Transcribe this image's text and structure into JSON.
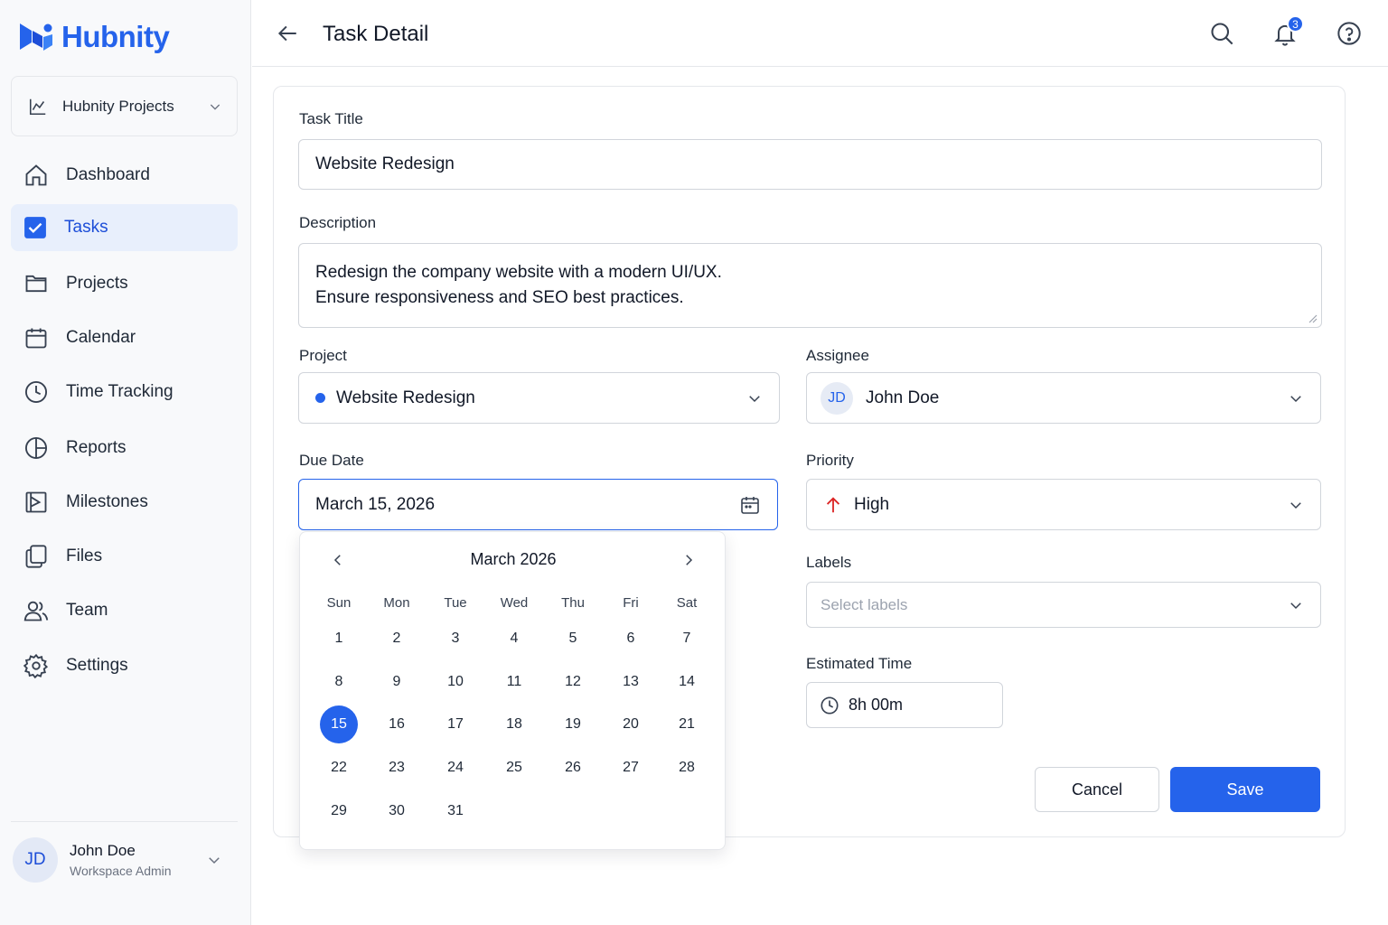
{
  "app": {
    "name": "Hubnity"
  },
  "workspace": {
    "label": "Hubnity Projects"
  },
  "sidebar": {
    "items": [
      {
        "label": "Dashboard",
        "icon": "home-icon"
      },
      {
        "label": "Tasks",
        "icon": "checkbox-icon",
        "active": true
      },
      {
        "label": "Projects",
        "icon": "folder-icon"
      },
      {
        "label": "Calendar",
        "icon": "calendar-icon"
      },
      {
        "label": "Time Tracking",
        "icon": "clock-icon"
      },
      {
        "label": "Reports",
        "icon": "pie-chart-icon"
      },
      {
        "label": "Milestones",
        "icon": "milestone-icon"
      },
      {
        "label": "Files",
        "icon": "files-icon"
      },
      {
        "label": "Team",
        "icon": "team-icon"
      },
      {
        "label": "Settings",
        "icon": "gear-icon"
      }
    ]
  },
  "user": {
    "initials": "JD",
    "name": "John Doe",
    "role": "Workspace Admin"
  },
  "header": {
    "title": "Task Detail",
    "notifications": "3"
  },
  "form": {
    "title_label": "Task Title",
    "title_value": "Website Redesign",
    "description_label": "Description",
    "description_line1": "Redesign the company website with a modern UI/UX.",
    "description_line2": "Ensure responsiveness and SEO best practices.",
    "project_label": "Project",
    "project_value": "Website Redesign",
    "assignee_label": "Assignee",
    "assignee_initials": "JD",
    "assignee_value": "John Doe",
    "due_date_label": "Due Date",
    "due_date_value": "March 15, 2026",
    "priority_label": "Priority",
    "priority_value": "High",
    "labels_label": "Labels",
    "labels_placeholder": "Select labels",
    "estimated_label": "Estimated Time",
    "estimated_value": "8h 00m",
    "cancel_label": "Cancel",
    "save_label": "Save"
  },
  "calendar": {
    "month": "March 2026",
    "weekdays": [
      "Sun",
      "Mon",
      "Tue",
      "Wed",
      "Thu",
      "Fri",
      "Sat"
    ],
    "days": [
      "1",
      "2",
      "3",
      "4",
      "5",
      "6",
      "7",
      "8",
      "9",
      "10",
      "11",
      "12",
      "13",
      "14",
      "15",
      "16",
      "17",
      "18",
      "19",
      "20",
      "21",
      "22",
      "23",
      "24",
      "25",
      "26",
      "27",
      "28",
      "29",
      "30",
      "31"
    ],
    "selected": "15"
  },
  "colors": {
    "accent": "#2563eb",
    "active_bg": "#e8effc",
    "priority_high": "#dc2626"
  }
}
